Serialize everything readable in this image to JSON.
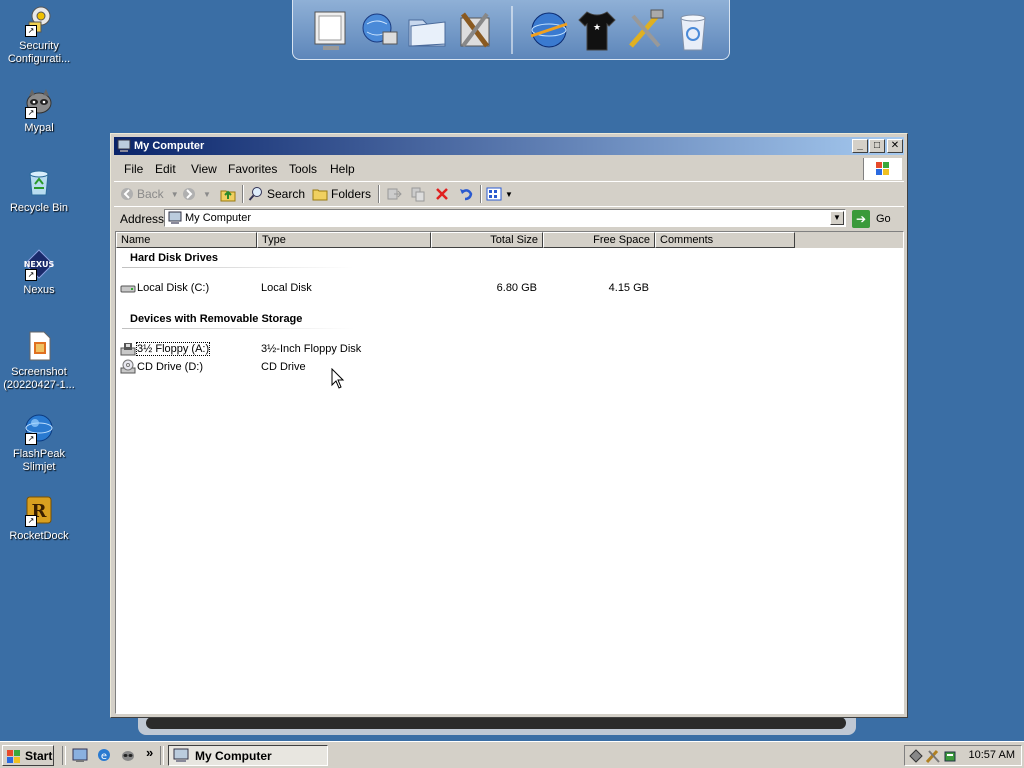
{
  "desktop": {
    "icons": [
      {
        "label": "Security\nConfigurati...",
        "icon": "security-config-icon"
      },
      {
        "label": "Mypal",
        "icon": "raccoon-icon"
      },
      {
        "label": "Recycle Bin",
        "icon": "recycle-bin-icon"
      },
      {
        "label": "Nexus",
        "icon": "nexus-icon"
      },
      {
        "label": "Screenshot\n(20220427-1...",
        "icon": "screenshot-file-icon"
      },
      {
        "label": "FlashPeak\nSlimjet",
        "icon": "slimjet-icon"
      },
      {
        "label": "RocketDock",
        "icon": "rocketdock-icon"
      }
    ]
  },
  "dock": {
    "items": [
      "monitor-icon",
      "globe-network-icon",
      "folder-icon",
      "tools-icon",
      "globe-icon",
      "tshirt-icon",
      "hammer-wrench-icon",
      "trash-icon"
    ]
  },
  "window": {
    "title": "My Computer",
    "menu": [
      "File",
      "Edit",
      "View",
      "Favorites",
      "Tools",
      "Help"
    ],
    "toolbar": {
      "back": "Back",
      "search": "Search",
      "folders": "Folders"
    },
    "address": {
      "label": "Address",
      "value": "My Computer",
      "go": "Go"
    },
    "columns": [
      "Name",
      "Type",
      "Total Size",
      "Free Space",
      "Comments"
    ],
    "groups": [
      {
        "title": "Hard Disk Drives",
        "items": [
          {
            "name": "Local Disk (C:)",
            "type": "Local Disk",
            "total": "6.80 GB",
            "free": "4.15 GB",
            "icon": "hard-disk-icon"
          }
        ]
      },
      {
        "title": "Devices with Removable Storage",
        "items": [
          {
            "name": "3½ Floppy (A:)",
            "type": "3½-Inch Floppy Disk",
            "total": "",
            "free": "",
            "icon": "floppy-drive-icon"
          },
          {
            "name": "CD Drive (D:)",
            "type": "CD Drive",
            "total": "",
            "free": "",
            "icon": "cd-drive-icon"
          }
        ]
      }
    ]
  },
  "taskbar": {
    "start": "Start",
    "task": "My Computer",
    "clock": "10:57 AM",
    "more": "»"
  },
  "colors": {
    "desktop": "#3a6ea5",
    "titlebar_start": "#0a246a",
    "titlebar_end": "#a6caf0",
    "chrome": "#d4d0c8"
  }
}
